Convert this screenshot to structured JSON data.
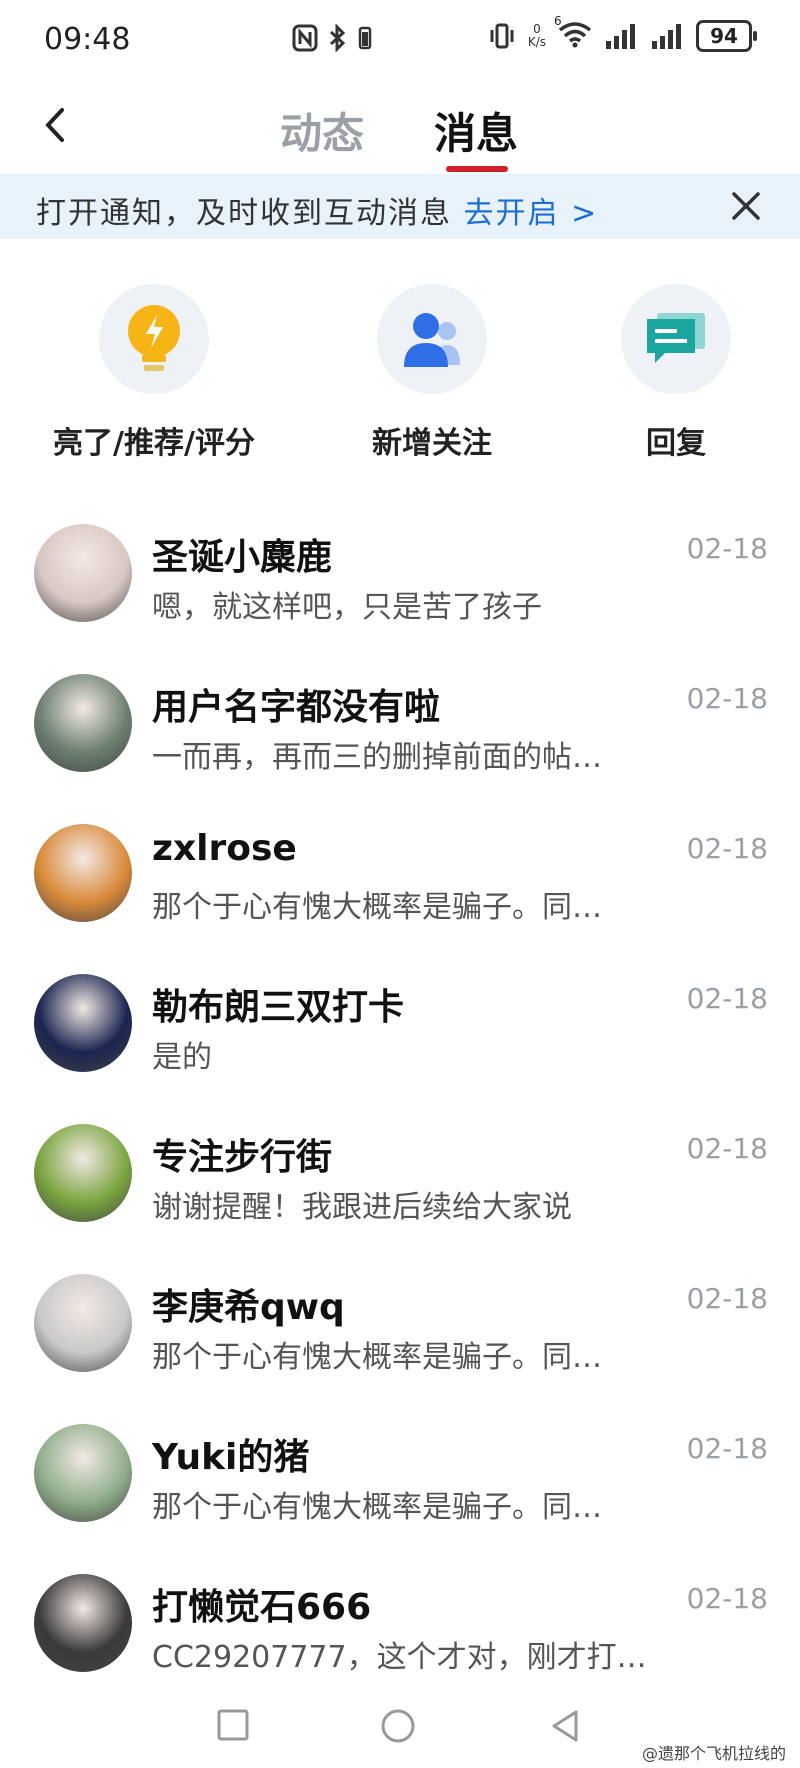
{
  "status": {
    "time": "09:48",
    "speed_value": "0",
    "speed_unit": "K/s",
    "network": "6",
    "battery": "94"
  },
  "header": {
    "tabs": [
      {
        "label": "动态",
        "active": false
      },
      {
        "label": "消息",
        "active": true
      }
    ]
  },
  "banner": {
    "text": "打开通知，及时收到互动消息",
    "link": "去开启 >"
  },
  "quick_actions": [
    {
      "label": "亮了/推荐/评分",
      "icon": "lightbulb-icon"
    },
    {
      "label": "新增关注",
      "icon": "users-icon"
    },
    {
      "label": "回复",
      "icon": "chat-icon"
    }
  ],
  "messages": [
    {
      "name": "圣诞小麋鹿",
      "preview": "嗯，就这样吧，只是苦了孩子",
      "date": "02-18",
      "avatar_color": "#d8c7c2"
    },
    {
      "name": "用户名字都没有啦",
      "preview": "一而再，再而三的删掉前面的帖…",
      "date": "02-18",
      "avatar_color": "#6b7f70"
    },
    {
      "name": "zxlrose",
      "preview": "那个于心有愧大概率是骗子。同…",
      "date": "02-18",
      "avatar_color": "#d98a3a"
    },
    {
      "name": "勒布朗三双打卡",
      "preview": "是的",
      "date": "02-18",
      "avatar_color": "#1a2550"
    },
    {
      "name": "专注步行街",
      "preview": "谢谢提醒！我跟进后续给大家说",
      "date": "02-18",
      "avatar_color": "#7aa540"
    },
    {
      "name": "李庚希qwq",
      "preview": "那个于心有愧大概率是骗子。同…",
      "date": "02-18",
      "avatar_color": "#c9c9c9"
    },
    {
      "name": "Yuki的猪",
      "preview": "那个于心有愧大概率是骗子。同…",
      "date": "02-18",
      "avatar_color": "#8fae8a"
    },
    {
      "name": "打懒觉石666",
      "preview": "CC29207777，这个才对，刚才打…",
      "date": "02-18",
      "avatar_color": "#3a3a3a"
    }
  ],
  "watermark": "@遗那个飞机拉线的"
}
